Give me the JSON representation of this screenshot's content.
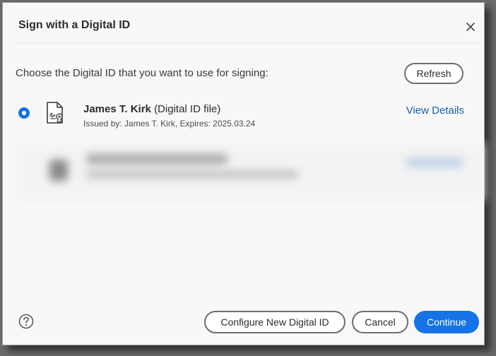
{
  "dialog": {
    "title": "Sign with a Digital ID",
    "prompt": "Choose the Digital ID that you want to use for signing:",
    "refresh_label": "Refresh"
  },
  "ids": [
    {
      "name": "James T. Kirk",
      "type": "(Digital ID file)",
      "issued": "Issued by: James T. Kirk, Expires: 2025.03.24",
      "details_label": "View Details",
      "selected": true
    }
  ],
  "footer": {
    "configure_label": "Configure New Digital ID",
    "cancel_label": "Cancel",
    "continue_label": "Continue"
  },
  "colors": {
    "accent": "#1473e6",
    "link": "#1a5fa8"
  },
  "icons": {
    "close": "close-icon",
    "help": "help-icon",
    "certificate": "certificate-icon"
  }
}
